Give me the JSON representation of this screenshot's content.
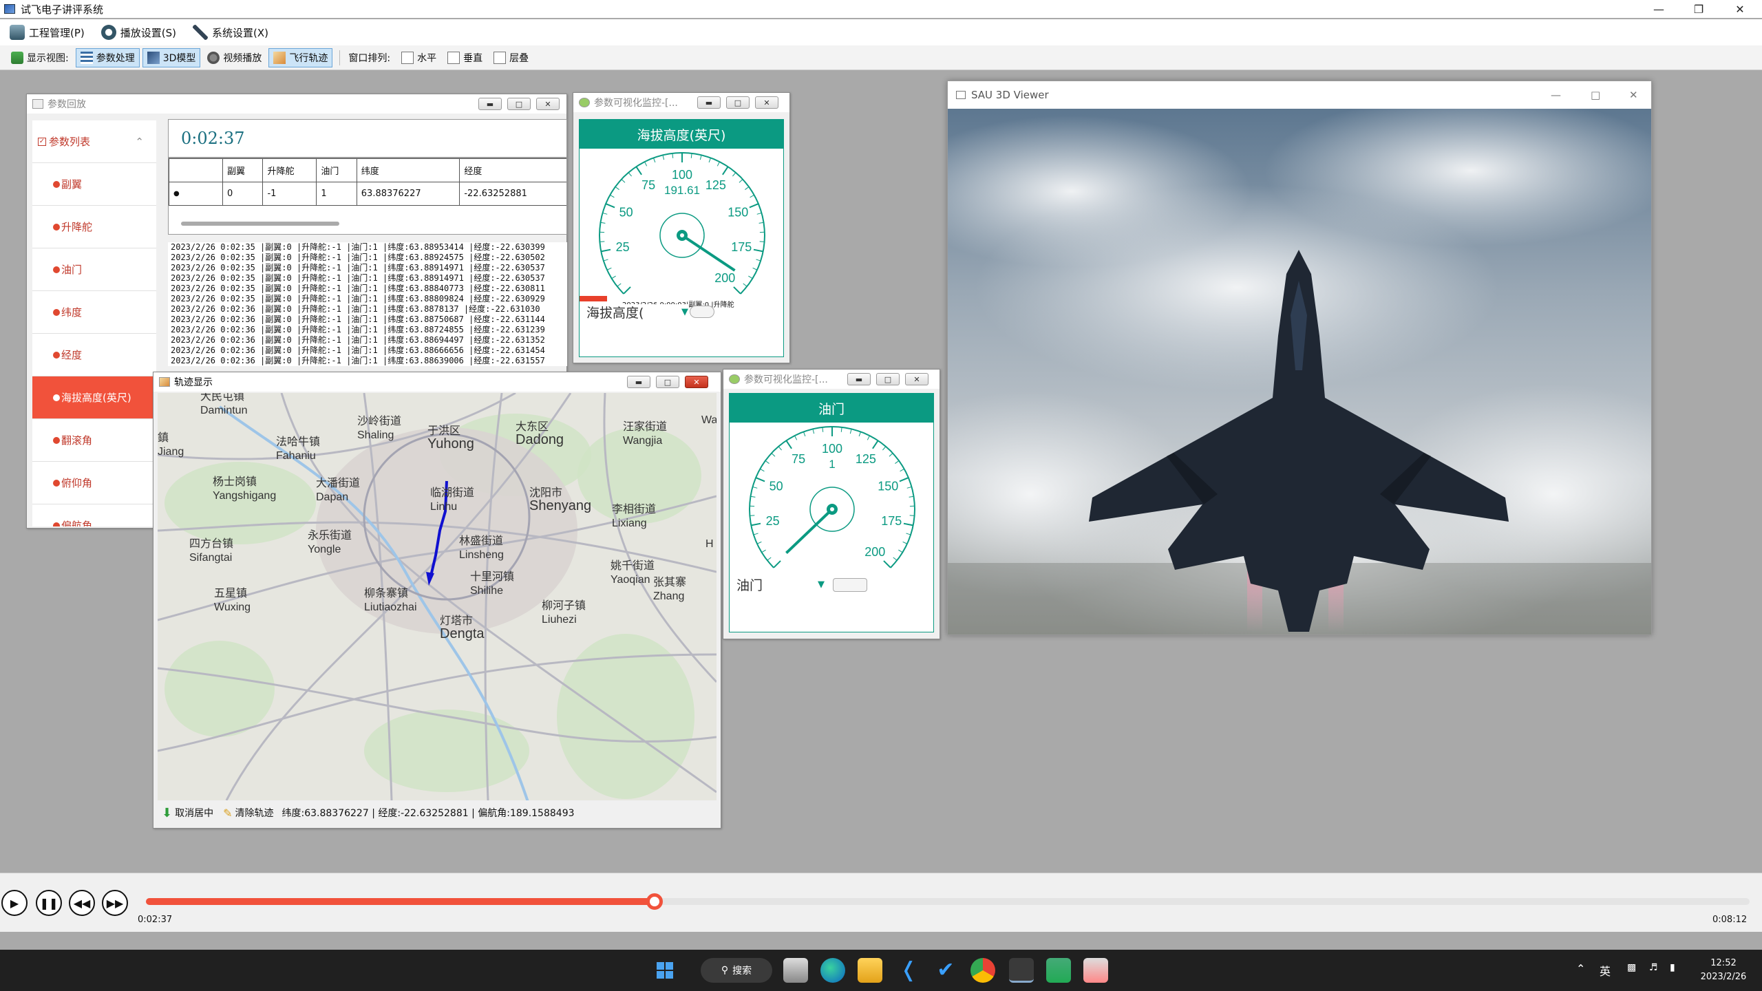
{
  "app": {
    "title": "试飞电子讲评系统"
  },
  "menu": [
    {
      "label": "工程管理(P)"
    },
    {
      "label": "播放设置(S)"
    },
    {
      "label": "系统设置(X)"
    }
  ],
  "toolbar": {
    "view_label": "显示视图:",
    "params": "参数处理",
    "model3d": "3D模型",
    "video": "视频播放",
    "track": "飞行轨迹",
    "arrange_label": "窗口排列:",
    "horizontal": "水平",
    "vertical": "垂直",
    "cascade": "层叠"
  },
  "param_window": {
    "title": "参数回放",
    "list_header": "参数列表",
    "items": [
      "副翼",
      "升降舵",
      "油门",
      "纬度",
      "经度",
      "海拔高度(英尺)",
      "翻滚角",
      "俯仰角",
      "偏航角"
    ],
    "selected_index": 5,
    "elapsed": "0:02:37",
    "table_headers": [
      "副翼",
      "升降舵",
      "油门",
      "纬度",
      "经度"
    ],
    "table_row": [
      "0",
      "-1",
      "1",
      "63.88376227",
      "-22.63252881"
    ],
    "log_lines": [
      "2023/2/26 0:02:35 |副翼:0 |升降舵:-1 |油门:1 |纬度:63.88953414 |经度:-22.630399",
      "2023/2/26 0:02:35 |副翼:0 |升降舵:-1 |油门:1 |纬度:63.88924575 |经度:-22.630502",
      "2023/2/26 0:02:35 |副翼:0 |升降舵:-1 |油门:1 |纬度:63.88914971 |经度:-22.630537",
      "2023/2/26 0:02:35 |副翼:0 |升降舵:-1 |油门:1 |纬度:63.88914971 |经度:-22.630537",
      "2023/2/26 0:02:35 |副翼:0 |升降舵:-1 |油门:1 |纬度:63.88840773 |经度:-22.630811",
      "2023/2/26 0:02:35 |副翼:0 |升降舵:-1 |油门:1 |纬度:63.88809824 |经度:-22.630929",
      "2023/2/26 0:02:36 |副翼:0 |升降舵:-1 |油门:1 |纬度:63.8878137 |经度:-22.631030",
      "2023/2/26 0:02:36 |副翼:0 |升降舵:-1 |油门:1 |纬度:63.88750687 |经度:-22.631144",
      "2023/2/26 0:02:36 |副翼:0 |升降舵:-1 |油门:1 |纬度:63.88724855 |经度:-22.631239",
      "2023/2/26 0:02:36 |副翼:0 |升降舵:-1 |油门:1 |纬度:63.88694497 |经度:-22.631352",
      "2023/2/26 0:02:36 |副翼:0 |升降舵:-1 |油门:1 |纬度:63.88666656 |经度:-22.631454",
      "2023/2/26 0:02:36 |副翼:0 |升降舵:-1 |油门:1 |纬度:63.88639006 |经度:-22.631557"
    ]
  },
  "gauge_alt": {
    "window_title": "参数可视化监控-[...",
    "title": "海拔高度(英尺)",
    "value": "191.61",
    "needle_value": 191.61,
    "min": 0,
    "max": 200,
    "ticks": [
      "25",
      "50",
      "75",
      "100",
      "125",
      "150",
      "175",
      "200"
    ],
    "select": "海拔高度(",
    "overlay_text": "2023/2/26 0:00:03|副翼:0 |升降舵"
  },
  "gauge_thr": {
    "window_title": "参数可视化监控-[...",
    "title": "油门",
    "value": "1",
    "needle_value": 1,
    "min": 0,
    "max": 200,
    "ticks": [
      "25",
      "50",
      "75",
      "100",
      "125",
      "150",
      "175",
      "200"
    ],
    "select": "油门"
  },
  "map_window": {
    "title": "轨迹显示",
    "places": [
      {
        "cn": "大民屯镇",
        "en": "Damintun"
      },
      {
        "cn": "沙岭街道",
        "en": "Shaling"
      },
      {
        "cn": "于洪区",
        "en": "Yuhong"
      },
      {
        "cn": "大东区",
        "en": "Dadong"
      },
      {
        "cn": "汪家街道",
        "en": "Wangjia"
      },
      {
        "cn": "法哈牛镇",
        "en": "Fahaniu"
      },
      {
        "cn": "杨士岗镇",
        "en": "Yangshigang"
      },
      {
        "cn": "大潘街道",
        "en": "Dapan"
      },
      {
        "cn": "临湖街道",
        "en": "Linhu"
      },
      {
        "cn": "沈阳市",
        "en": "Shenyang"
      },
      {
        "cn": "李相街道",
        "en": "Lixiang"
      },
      {
        "cn": "四方台镇",
        "en": "Sifangtai"
      },
      {
        "cn": "永乐街道",
        "en": "Yongle"
      },
      {
        "cn": "林盛街道",
        "en": "Linsheng"
      },
      {
        "cn": "姚千街道",
        "en": "Yaoqian"
      },
      {
        "cn": "十里河镇",
        "en": "Shilihe"
      },
      {
        "cn": "张其寨",
        "en": "Zhang"
      },
      {
        "cn": "五星镇",
        "en": "Wuxing"
      },
      {
        "cn": "柳条寨镇",
        "en": "Liutiaozhai"
      },
      {
        "cn": "柳河子镇",
        "en": "Liuhezi"
      },
      {
        "cn": "灯塔市",
        "en": "Dengta"
      },
      {
        "cn": "鎮",
        "en": "Jiang"
      }
    ],
    "edge_labels": [
      "Wa",
      "H"
    ],
    "btn_uncenter": "取消居中",
    "btn_clear": "清除轨迹",
    "status": "纬度:63.88376227 | 经度:-22.63252881 | 偏航角:189.1588493"
  },
  "viewer": {
    "title": "SAU 3D Viewer"
  },
  "player": {
    "current": "0:02:37",
    "total": "0:08:12",
    "progress": 0.317
  },
  "taskbar": {
    "search": "搜索",
    "ime": "英",
    "time": "12:52",
    "date": "2023/2/26"
  },
  "colors": {
    "accent": "#0b9a82",
    "selected": "#f1523b",
    "progress": "#f1523b"
  }
}
